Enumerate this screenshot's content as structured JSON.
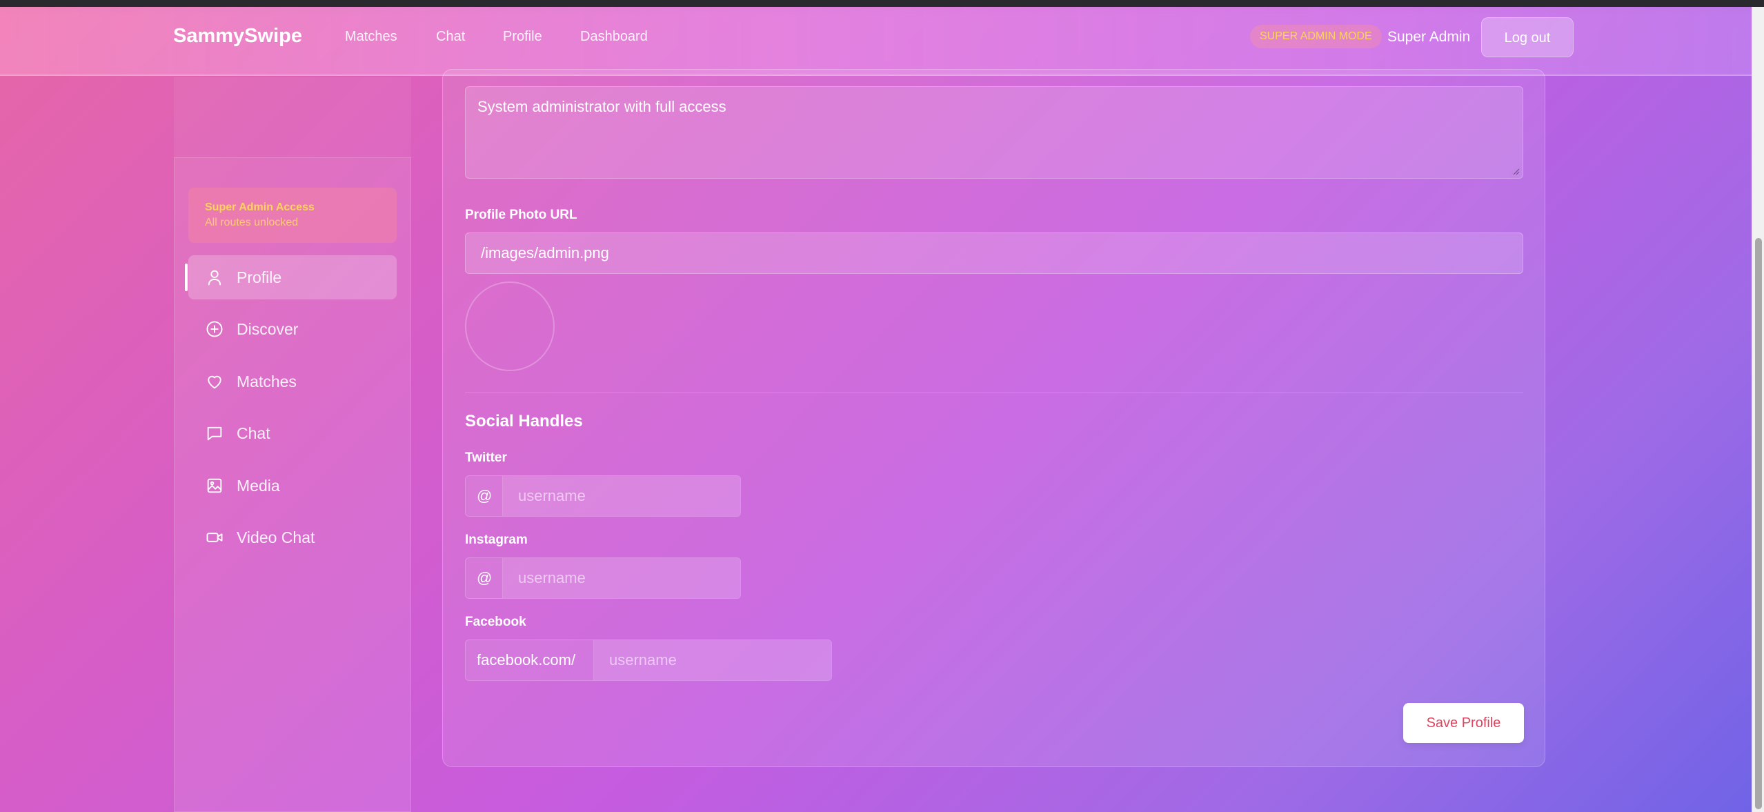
{
  "navbar": {
    "brand": "SammySwipe",
    "links": [
      "Matches",
      "Chat",
      "Profile",
      "Dashboard"
    ],
    "admin_badge": "SUPER ADMIN MODE",
    "user_name": "Super Admin",
    "logout_label": "Log out"
  },
  "sidebar": {
    "access_title": "Super Admin Access",
    "access_subtitle": "All routes unlocked",
    "items": [
      {
        "label": "Profile",
        "icon": "user-icon",
        "active": true
      },
      {
        "label": "Discover",
        "icon": "plus-circle-icon",
        "active": false
      },
      {
        "label": "Matches",
        "icon": "heart-icon",
        "active": false
      },
      {
        "label": "Chat",
        "icon": "chat-bubble-icon",
        "active": false
      },
      {
        "label": "Media",
        "icon": "image-icon",
        "active": false
      },
      {
        "label": "Video Chat",
        "icon": "video-icon",
        "active": false
      }
    ]
  },
  "profile_form": {
    "bio_value": "System administrator with full access",
    "photo_url_label": "Profile Photo URL",
    "photo_url_value": "/images/admin.png",
    "social_heading": "Social Handles",
    "twitter": {
      "label": "Twitter",
      "prefix": "@",
      "placeholder": "username"
    },
    "instagram": {
      "label": "Instagram",
      "prefix": "@",
      "placeholder": "username"
    },
    "facebook": {
      "label": "Facebook",
      "prefix": "facebook.com/",
      "placeholder": "username"
    },
    "save_label": "Save Profile"
  },
  "colors": {
    "accent_yellow": "#ffd35c",
    "save_text": "#e0445e"
  }
}
